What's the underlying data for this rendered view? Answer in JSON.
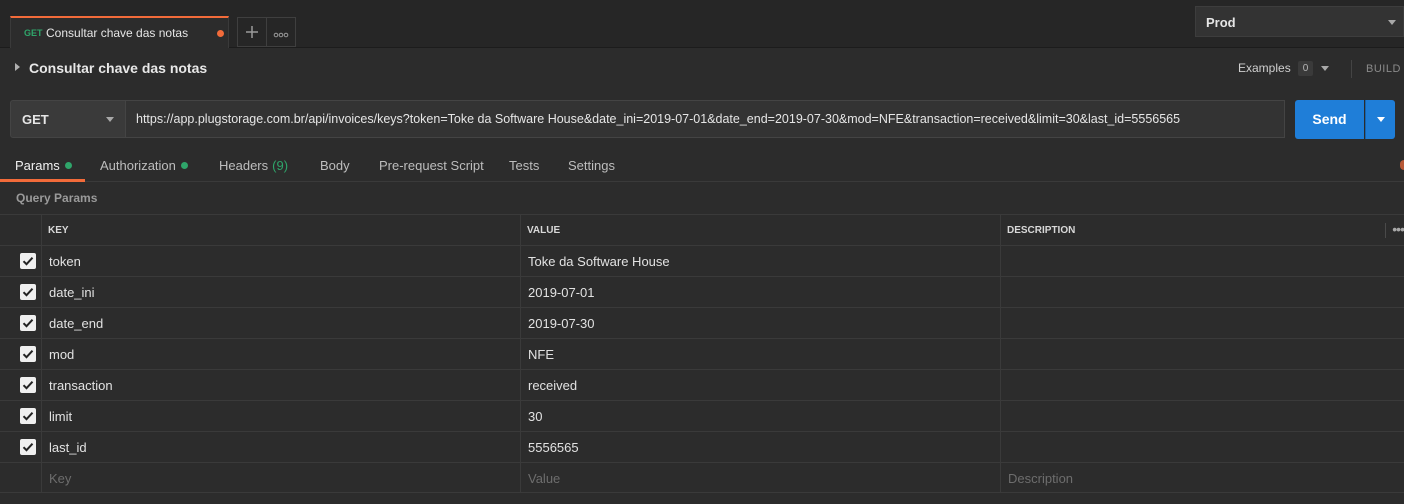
{
  "tab": {
    "method": "GET",
    "name": "Consultar chave das notas",
    "unsaved": true,
    "new_tab_icon": "plus-icon",
    "more_icon": "more-horizontal-icon"
  },
  "environment": {
    "selected": "Prod"
  },
  "request": {
    "title": "Consultar chave das notas",
    "examples_label": "Examples",
    "examples_count": "0",
    "build_label": "BUILD",
    "method": "GET",
    "url": "https://app.plugstorage.com.br/api/invoices/keys?token=Toke da Software House&date_ini=2019-07-01&date_end=2019-07-30&mod=NFE&transaction=received&limit=30&last_id=5556565",
    "send_label": "Send"
  },
  "subtabs": [
    {
      "label": "Params",
      "active": true,
      "dot": true
    },
    {
      "label": "Authorization",
      "dot": true
    },
    {
      "label": "Headers",
      "count": "(9)"
    },
    {
      "label": "Body"
    },
    {
      "label": "Pre-request Script"
    },
    {
      "label": "Tests"
    },
    {
      "label": "Settings"
    }
  ],
  "params": {
    "section_label": "Query Params",
    "headers": {
      "key": "KEY",
      "value": "VALUE",
      "description": "DESCRIPTION"
    },
    "rows": [
      {
        "checked": true,
        "key": "token",
        "value": "Toke da Software House",
        "description": ""
      },
      {
        "checked": true,
        "key": "date_ini",
        "value": "2019-07-01",
        "description": ""
      },
      {
        "checked": true,
        "key": "date_end",
        "value": "2019-07-30",
        "description": ""
      },
      {
        "checked": true,
        "key": "mod",
        "value": "NFE",
        "description": ""
      },
      {
        "checked": true,
        "key": "transaction",
        "value": "received",
        "description": ""
      },
      {
        "checked": true,
        "key": "limit",
        "value": "30",
        "description": ""
      },
      {
        "checked": true,
        "key": "last_id",
        "value": "5556565",
        "description": ""
      }
    ],
    "new_row": {
      "key_placeholder": "Key",
      "value_placeholder": "Value",
      "description_placeholder": "Description"
    }
  },
  "colors": {
    "accent": "#f26b3a",
    "send_button": "#1f7ed8",
    "get_method": "#2fa56a",
    "status_dot": "#2fa56a"
  }
}
